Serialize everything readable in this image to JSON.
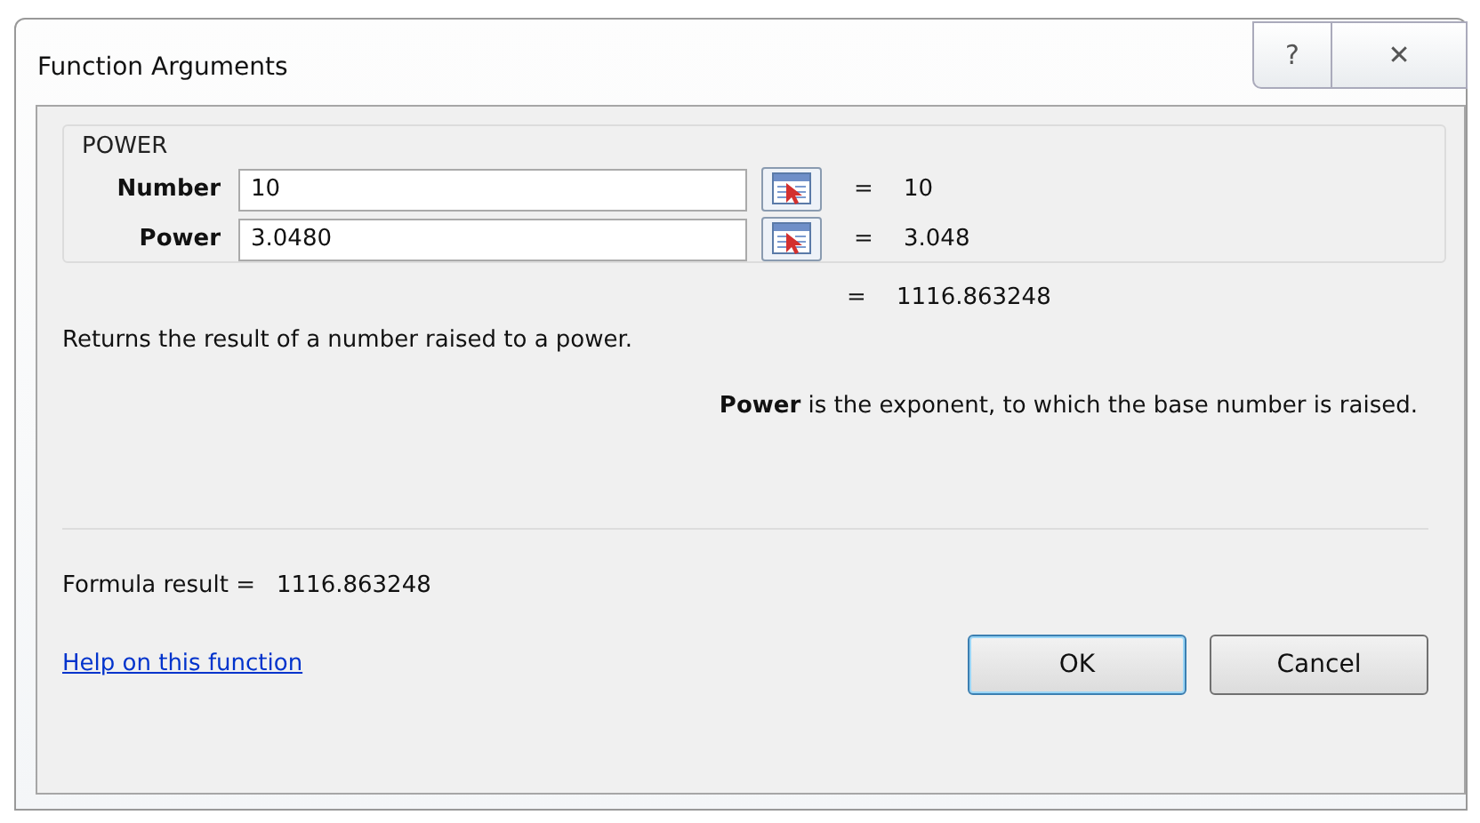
{
  "window": {
    "title": "Function Arguments",
    "help": "?",
    "close": "✕"
  },
  "function_name": "POWER",
  "arguments": [
    {
      "label": "Number",
      "value": "10",
      "equals": "=",
      "result": "10"
    },
    {
      "label": "Power",
      "value": "3.0480",
      "equals": "=",
      "result": "3.048"
    }
  ],
  "total": {
    "equals": "=",
    "result": "1116.863248"
  },
  "description": "Returns the result of a number raised to a power.",
  "argument_help": "**Power**  is the exponent, to which the base number is raised.",
  "formula_result": {
    "label": "Formula result =",
    "value": "1116.863248"
  },
  "help_link": "Help on this function",
  "buttons": [
    {
      "label": "OK",
      "kind": "default"
    },
    {
      "label": "Cancel",
      "kind": "normal"
    }
  ]
}
